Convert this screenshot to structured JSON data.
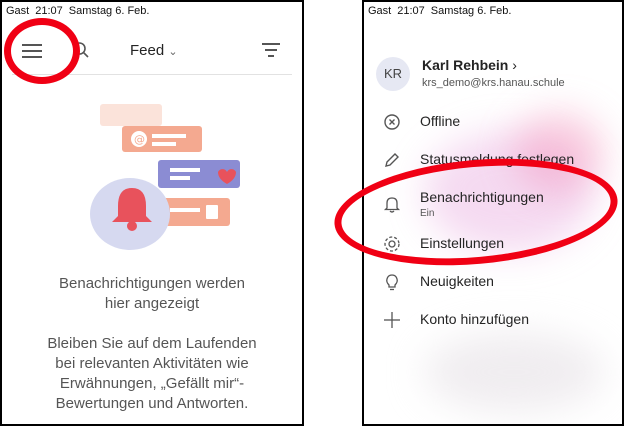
{
  "left": {
    "status": {
      "carrier": "Gast",
      "time": "21:07",
      "date": "Samstag 6. Feb."
    },
    "header": {
      "title": "Feed"
    },
    "empty_state": {
      "title_line1": "Benachrichtigungen werden",
      "title_line2": "hier angezeigt",
      "body_lines": [
        "Bleiben Sie auf dem Laufenden",
        "bei relevanten Aktivitäten wie",
        "Erwähnungen, „Gefällt mir“-",
        "Bewertungen und Antworten."
      ]
    }
  },
  "right": {
    "status": {
      "carrier": "Gast",
      "time": "21:07",
      "date": "Samstag 6. Feb."
    },
    "user": {
      "initials": "KR",
      "name": "Karl Rehbein",
      "email": "krs_demo@krs.hanau.schule"
    },
    "menu": [
      {
        "label": "Offline",
        "icon": "offline-icon"
      },
      {
        "label": "Statusmeldung festlegen",
        "icon": "edit-icon"
      },
      {
        "label": "Benachrichtigungen",
        "sub": "Ein",
        "icon": "bell-icon"
      },
      {
        "label": "Einstellungen",
        "icon": "gear-icon"
      },
      {
        "label": "Neuigkeiten",
        "icon": "lightbulb-icon"
      },
      {
        "label": "Konto hinzufügen",
        "icon": "plus-icon"
      }
    ]
  },
  "colors": {
    "annotation": "#f00014",
    "accent": "#6264a7"
  }
}
